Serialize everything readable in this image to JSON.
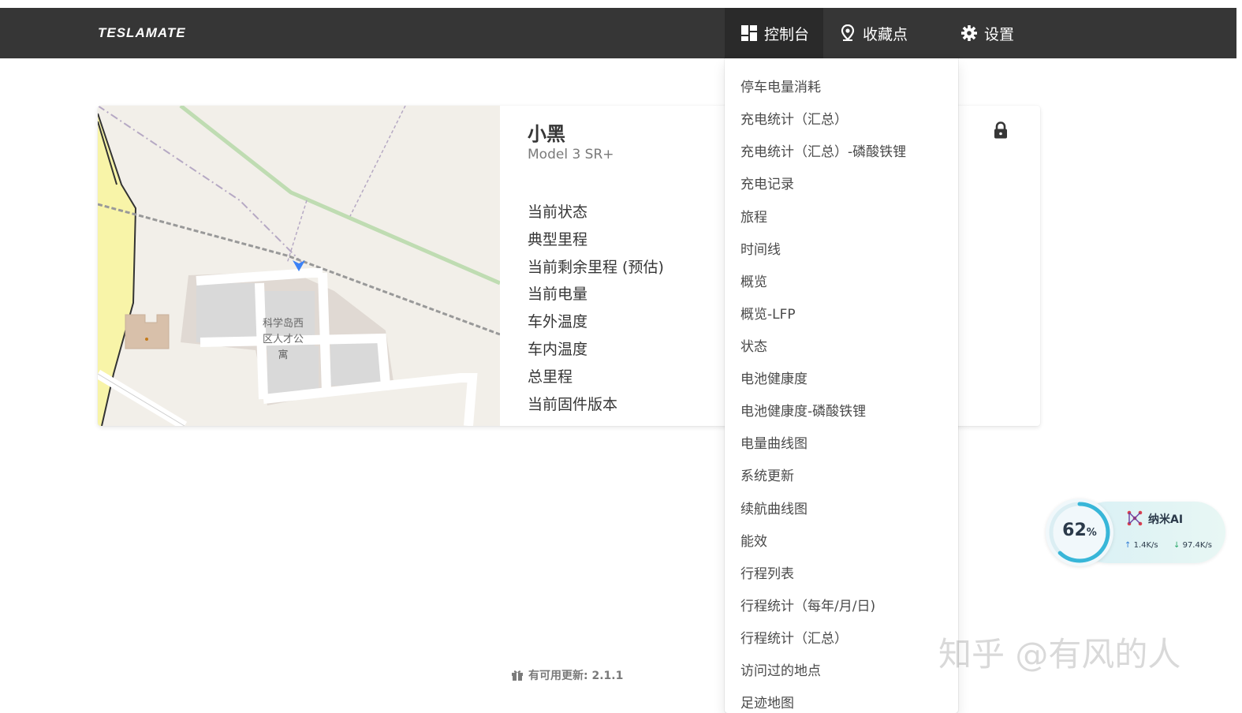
{
  "navbar": {
    "brand": "TESLAMATE",
    "items": [
      {
        "label": "控制台",
        "icon": "dashboard-icon"
      },
      {
        "label": "收藏点",
        "icon": "map-pin-icon"
      },
      {
        "label": "设置",
        "icon": "gear-icon"
      }
    ]
  },
  "car": {
    "name": "小黑",
    "model": "Model 3 SR+",
    "stat_labels": [
      "当前状态",
      "典型里程",
      "当前剩余里程 (预估)",
      "当前电量",
      "车外温度",
      "车内温度",
      "总里程",
      "当前固件版本"
    ],
    "locked_icon": "lock-icon"
  },
  "map": {
    "place_label": "科学岛西区人才公寓",
    "place_label_lines": [
      "科学岛西",
      "区人才公",
      "寓"
    ],
    "marker_color": "#3b82f6"
  },
  "dashboard_menu": {
    "items": [
      "停车电量消耗",
      "充电统计（汇总）",
      "充电统计（汇总）-磷酸铁锂",
      "充电记录",
      "旅程",
      "时间线",
      "概览",
      "概览-LFP",
      "状态",
      "电池健康度",
      "电池健康度-磷酸铁锂",
      "电量曲线图",
      "系统更新",
      "续航曲线图",
      "能效",
      "行程列表",
      "行程统计（每年/月/日)",
      "行程统计（汇总）",
      "访问过的地点",
      "足迹地图"
    ]
  },
  "footer": {
    "update_text": "有可用更新: 2.1.1"
  },
  "widget": {
    "percent": "62",
    "percent_unit": "%",
    "title": "纳米AI",
    "upload": "1.4K/s",
    "download": "97.4K/s",
    "progress": 0.62
  },
  "watermark": "知乎 @有风的人",
  "colors": {
    "navbar_bg": "#363636",
    "navbar_active_bg": "#2a2a2a",
    "text": "#363636",
    "muted": "#7a7a7a"
  }
}
